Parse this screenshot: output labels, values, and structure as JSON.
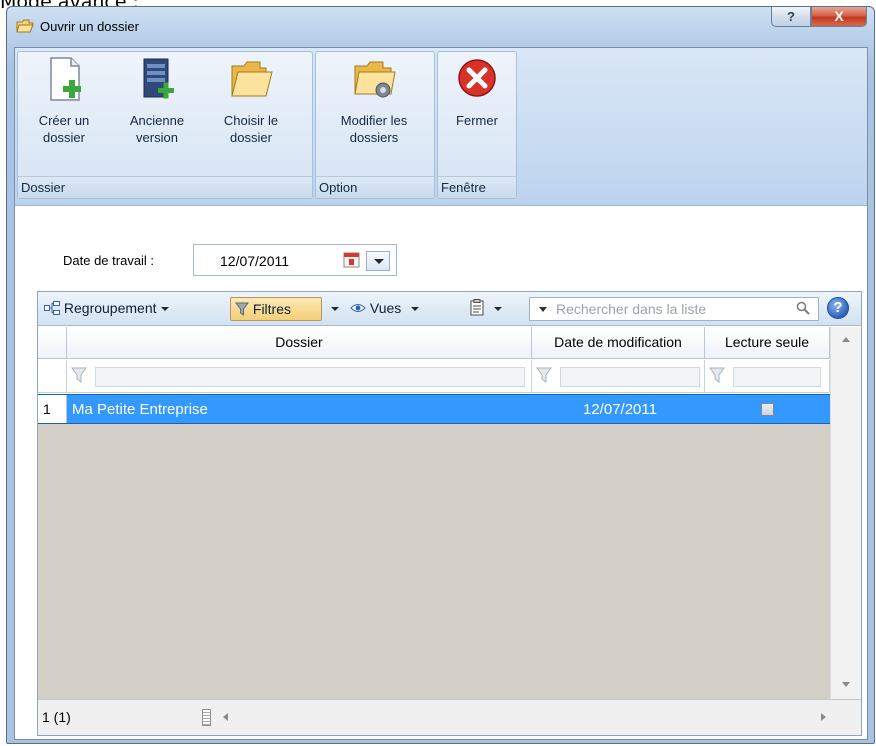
{
  "page_heading": "Mode avancé :",
  "window": {
    "title": "Ouvrir un dossier",
    "help_symbol": "?",
    "close_symbol": "X"
  },
  "ribbon": {
    "groups": [
      {
        "caption": "Dossier",
        "buttons": [
          {
            "line1": "Créer un",
            "line2": "dossier",
            "icon": "new-document-plus-icon"
          },
          {
            "line1": "Ancienne",
            "line2": "version",
            "icon": "server-plus-icon"
          },
          {
            "line1": "Choisir le",
            "line2": "dossier",
            "icon": "open-folder-icon"
          }
        ]
      },
      {
        "caption": "Option",
        "buttons": [
          {
            "line1": "Modifier les",
            "line2": "dossiers",
            "icon": "folder-gear-icon"
          }
        ]
      },
      {
        "caption": "Fenêtre",
        "buttons": [
          {
            "line1": "Fermer",
            "line2": "",
            "icon": "red-close-icon"
          }
        ]
      }
    ]
  },
  "work_date": {
    "label": "Date de travail :",
    "value": "12/07/2011"
  },
  "toolbar": {
    "grouping": "Regroupement",
    "filters": "Filtres",
    "views": "Vues",
    "search_placeholder": "Rechercher dans la liste",
    "help": "?"
  },
  "table": {
    "columns": [
      "Dossier",
      "Date de modification",
      "Lecture seule"
    ],
    "rows": [
      {
        "index": "1",
        "dossier": "Ma Petite Entreprise",
        "date": "12/07/2011",
        "read_only": false
      }
    ]
  },
  "status": {
    "count": "1 (1)"
  },
  "colors": {
    "selection": "#3399ff",
    "ribbon": "#c6daf1",
    "empty_area": "#d4d0c8"
  }
}
